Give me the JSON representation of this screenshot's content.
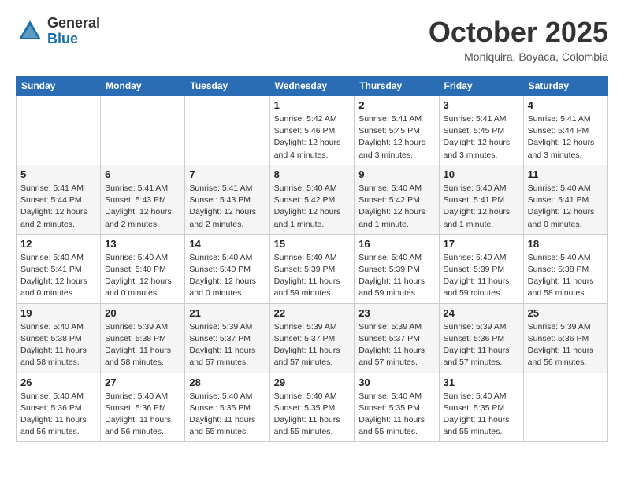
{
  "header": {
    "logo_general": "General",
    "logo_blue": "Blue",
    "title": "October 2025",
    "location": "Moniquira, Boyaca, Colombia"
  },
  "weekdays": [
    "Sunday",
    "Monday",
    "Tuesday",
    "Wednesday",
    "Thursday",
    "Friday",
    "Saturday"
  ],
  "weeks": [
    [
      {
        "day": "",
        "info": ""
      },
      {
        "day": "",
        "info": ""
      },
      {
        "day": "",
        "info": ""
      },
      {
        "day": "1",
        "info": "Sunrise: 5:42 AM\nSunset: 5:46 PM\nDaylight: 12 hours\nand 4 minutes."
      },
      {
        "day": "2",
        "info": "Sunrise: 5:41 AM\nSunset: 5:45 PM\nDaylight: 12 hours\nand 3 minutes."
      },
      {
        "day": "3",
        "info": "Sunrise: 5:41 AM\nSunset: 5:45 PM\nDaylight: 12 hours\nand 3 minutes."
      },
      {
        "day": "4",
        "info": "Sunrise: 5:41 AM\nSunset: 5:44 PM\nDaylight: 12 hours\nand 3 minutes."
      }
    ],
    [
      {
        "day": "5",
        "info": "Sunrise: 5:41 AM\nSunset: 5:44 PM\nDaylight: 12 hours\nand 2 minutes."
      },
      {
        "day": "6",
        "info": "Sunrise: 5:41 AM\nSunset: 5:43 PM\nDaylight: 12 hours\nand 2 minutes."
      },
      {
        "day": "7",
        "info": "Sunrise: 5:41 AM\nSunset: 5:43 PM\nDaylight: 12 hours\nand 2 minutes."
      },
      {
        "day": "8",
        "info": "Sunrise: 5:40 AM\nSunset: 5:42 PM\nDaylight: 12 hours\nand 1 minute."
      },
      {
        "day": "9",
        "info": "Sunrise: 5:40 AM\nSunset: 5:42 PM\nDaylight: 12 hours\nand 1 minute."
      },
      {
        "day": "10",
        "info": "Sunrise: 5:40 AM\nSunset: 5:41 PM\nDaylight: 12 hours\nand 1 minute."
      },
      {
        "day": "11",
        "info": "Sunrise: 5:40 AM\nSunset: 5:41 PM\nDaylight: 12 hours\nand 0 minutes."
      }
    ],
    [
      {
        "day": "12",
        "info": "Sunrise: 5:40 AM\nSunset: 5:41 PM\nDaylight: 12 hours\nand 0 minutes."
      },
      {
        "day": "13",
        "info": "Sunrise: 5:40 AM\nSunset: 5:40 PM\nDaylight: 12 hours\nand 0 minutes."
      },
      {
        "day": "14",
        "info": "Sunrise: 5:40 AM\nSunset: 5:40 PM\nDaylight: 12 hours\nand 0 minutes."
      },
      {
        "day": "15",
        "info": "Sunrise: 5:40 AM\nSunset: 5:39 PM\nDaylight: 11 hours\nand 59 minutes."
      },
      {
        "day": "16",
        "info": "Sunrise: 5:40 AM\nSunset: 5:39 PM\nDaylight: 11 hours\nand 59 minutes."
      },
      {
        "day": "17",
        "info": "Sunrise: 5:40 AM\nSunset: 5:39 PM\nDaylight: 11 hours\nand 59 minutes."
      },
      {
        "day": "18",
        "info": "Sunrise: 5:40 AM\nSunset: 5:38 PM\nDaylight: 11 hours\nand 58 minutes."
      }
    ],
    [
      {
        "day": "19",
        "info": "Sunrise: 5:40 AM\nSunset: 5:38 PM\nDaylight: 11 hours\nand 58 minutes."
      },
      {
        "day": "20",
        "info": "Sunrise: 5:39 AM\nSunset: 5:38 PM\nDaylight: 11 hours\nand 58 minutes."
      },
      {
        "day": "21",
        "info": "Sunrise: 5:39 AM\nSunset: 5:37 PM\nDaylight: 11 hours\nand 57 minutes."
      },
      {
        "day": "22",
        "info": "Sunrise: 5:39 AM\nSunset: 5:37 PM\nDaylight: 11 hours\nand 57 minutes."
      },
      {
        "day": "23",
        "info": "Sunrise: 5:39 AM\nSunset: 5:37 PM\nDaylight: 11 hours\nand 57 minutes."
      },
      {
        "day": "24",
        "info": "Sunrise: 5:39 AM\nSunset: 5:36 PM\nDaylight: 11 hours\nand 57 minutes."
      },
      {
        "day": "25",
        "info": "Sunrise: 5:39 AM\nSunset: 5:36 PM\nDaylight: 11 hours\nand 56 minutes."
      }
    ],
    [
      {
        "day": "26",
        "info": "Sunrise: 5:40 AM\nSunset: 5:36 PM\nDaylight: 11 hours\nand 56 minutes."
      },
      {
        "day": "27",
        "info": "Sunrise: 5:40 AM\nSunset: 5:36 PM\nDaylight: 11 hours\nand 56 minutes."
      },
      {
        "day": "28",
        "info": "Sunrise: 5:40 AM\nSunset: 5:35 PM\nDaylight: 11 hours\nand 55 minutes."
      },
      {
        "day": "29",
        "info": "Sunrise: 5:40 AM\nSunset: 5:35 PM\nDaylight: 11 hours\nand 55 minutes."
      },
      {
        "day": "30",
        "info": "Sunrise: 5:40 AM\nSunset: 5:35 PM\nDaylight: 11 hours\nand 55 minutes."
      },
      {
        "day": "31",
        "info": "Sunrise: 5:40 AM\nSunset: 5:35 PM\nDaylight: 11 hours\nand 55 minutes."
      },
      {
        "day": "",
        "info": ""
      }
    ]
  ]
}
